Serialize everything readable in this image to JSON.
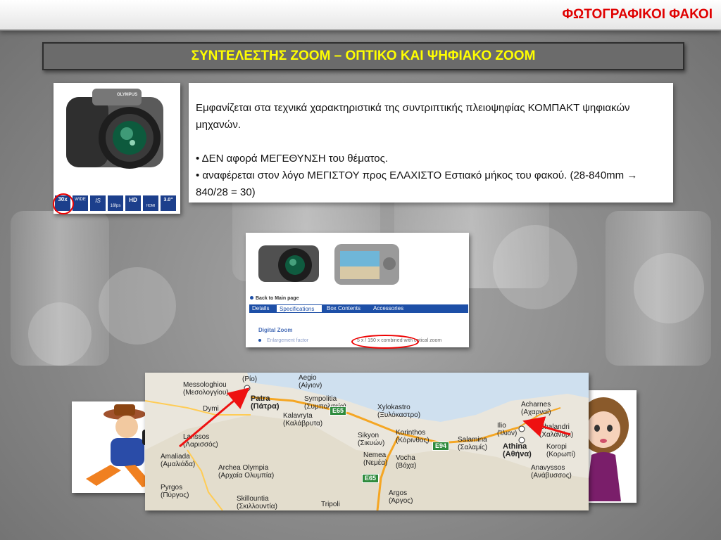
{
  "deck_title": "ΦΩΤΟΓΡΑΦΙΚΟΙ ΦΑΚΟΙ",
  "slide_heading": "ΣΥΝΤΕΛΕΣΤΗΣ ZOOM – ΟΠΤΙΚΟ ΚΑΙ ΨΗΦΙΑΚΟ ZOOM",
  "body": {
    "intro": "Εμφανίζεται στα τεχνικά χαρακτηριστικά της συντριπτικής πλειοψηφίας ΚΟΜΠΑΚΤ ψηφιακών μηχανών.",
    "bullet1": "• ΔΕΝ αφορά ΜΕΓΕΘΥΝΣΗ του θέματος.",
    "bullet2_text": "• αναφέρεται στον λόγο ΜΕΓΙΣΤΟΥ προς ΕΛΑΧΙΣΤΟ Εστιακό μήκος του φακού. (28-840mm ",
    "bullet2_arrow": "→",
    "bullet2_tail": " 840/28 = 30)"
  },
  "camera_photo": {
    "brand": "OLYMPUS",
    "feature_icons": [
      "30x",
      "WIDE",
      "IS",
      "16fps",
      "HD",
      "HDMI",
      "3.0\""
    ],
    "feature_sublabels": [
      "OPTICAL ZOOM",
      "28mm",
      "",
      "",
      "MOVIE",
      "",
      ""
    ]
  },
  "spec_page": {
    "back_link": "Back to Main page",
    "tabs": [
      "Details",
      "Specifications",
      "Box Contents",
      "Accessories"
    ],
    "section_title": "Digital Zoom",
    "row_label": "Enlargement factor",
    "row_value": "5 x / 150 x combined with optical zoom"
  },
  "map": {
    "places": [
      {
        "name": "Aegio",
        "greek": "(Αίγιον)"
      },
      {
        "name": "Messologhiou",
        "greek": "(Μεσολογγίου)"
      },
      {
        "name": "Patra",
        "greek": "(Πάτρα)"
      },
      {
        "name": "Sympolitia",
        "greek": "(Συμπολιτεία)"
      },
      {
        "name": "Kalavryta",
        "greek": "(Καλάβρυτα)"
      },
      {
        "name": "Xylokastro",
        "greek": "(Ξυλόκαστρο)"
      },
      {
        "name": "Acharnes",
        "greek": "(Αχαρναί)"
      },
      {
        "name": "Chalandri",
        "greek": "(Χαλάνδρι)"
      },
      {
        "name": "Ilio",
        "greek": "(Ίλιον)"
      },
      {
        "name": "Athina",
        "greek": "(Αθήνα)"
      },
      {
        "name": "Korinthos",
        "greek": "(Κόρινθος)"
      },
      {
        "name": "Sikyon",
        "greek": "(Σικυών)"
      },
      {
        "name": "Salamina",
        "greek": "(Σαλαμίς)"
      },
      {
        "name": "Nemea",
        "greek": "(Νεμέα)"
      },
      {
        "name": "Vocha",
        "greek": "(Βόχα)"
      },
      {
        "name": "Larissos",
        "greek": "(Λαρισσός)"
      },
      {
        "name": "Amaliada",
        "greek": "(Αμαλιάδα)"
      },
      {
        "name": "Archea Olympia",
        "greek": "(Αρχαία Ολυμπία)"
      },
      {
        "name": "Pyrgos",
        "greek": "(Πύργος)"
      },
      {
        "name": "Skillountia",
        "greek": "(Σκιλλουντία)"
      },
      {
        "name": "Tripoli",
        "greek": ""
      },
      {
        "name": "Argos",
        "greek": "(Άργος)"
      },
      {
        "name": "Anavyssos",
        "greek": "(Ανάβυσσος)"
      },
      {
        "name": "Koropi",
        "greek": "(Κορωπί)"
      },
      {
        "name": "Dymi",
        "greek": ""
      },
      {
        "name": "Rio",
        "greek": "(Ρίο)"
      }
    ],
    "road_shields": [
      "E65",
      "E94",
      "E65"
    ]
  },
  "colors": {
    "deck_title": "#e00000",
    "heading_text": "#ffff00",
    "heading_band": "#6b6b6b",
    "arrows": "#ee1111"
  }
}
